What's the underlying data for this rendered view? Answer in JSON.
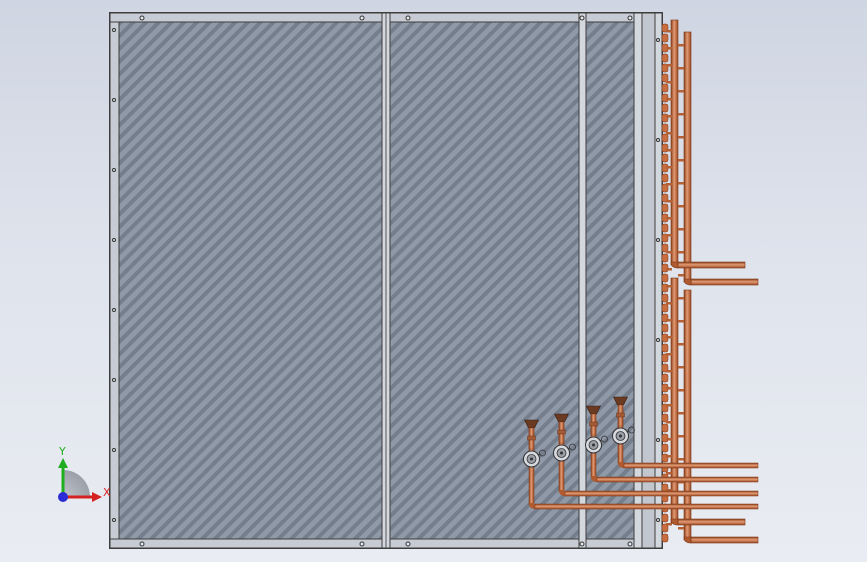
{
  "triad": {
    "x_label": "X",
    "y_label": "Y",
    "x_color": "#d42222",
    "y_color": "#1fae1f",
    "z_color": "#2a2ad6"
  },
  "colors": {
    "frame": "#4a4a4a",
    "fin": "#8d97a6",
    "fin_stripe": "#6f7886",
    "copper": "#c46a3c",
    "copper_dark": "#8a3f1c",
    "copper_light": "#e8a07a",
    "brass": "#7a5a3a"
  },
  "icons": {
    "triad": "coordinate-triad-icon"
  }
}
